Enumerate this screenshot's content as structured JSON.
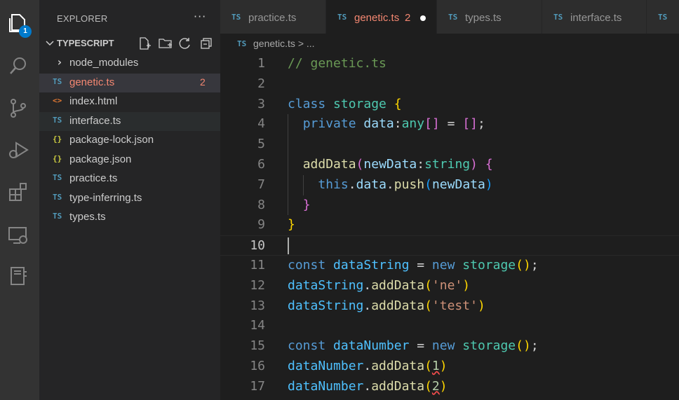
{
  "activity_bar": {
    "items": [
      {
        "name": "explorer-icon",
        "badge": "1"
      },
      {
        "name": "search-icon"
      },
      {
        "name": "source-control-icon"
      },
      {
        "name": "run-debug-icon"
      },
      {
        "name": "extensions-icon"
      },
      {
        "name": "remote-explorer-icon"
      },
      {
        "name": "notebook-icon"
      }
    ],
    "badge": "1"
  },
  "sidebar": {
    "title": "EXPLORER",
    "more": "···",
    "folder": "TYPESCRIPT",
    "items": [
      {
        "icon": "›",
        "name": "node_modules",
        "type": "folder"
      },
      {
        "icon": "TS",
        "name": "genetic.ts",
        "count": "2",
        "icon_color": "#519aba"
      },
      {
        "icon": "<>",
        "name": "index.html",
        "icon_color": "#e37933"
      },
      {
        "icon": "TS",
        "name": "interface.ts",
        "icon_color": "#519aba"
      },
      {
        "icon": "{}",
        "name": "package-lock.json",
        "icon_color": "#cbcb41"
      },
      {
        "icon": "{}",
        "name": "package.json",
        "icon_color": "#cbcb41"
      },
      {
        "icon": "TS",
        "name": "practice.ts",
        "icon_color": "#519aba"
      },
      {
        "icon": "TS",
        "name": "type-inferring.ts",
        "icon_color": "#519aba"
      },
      {
        "icon": "TS",
        "name": "types.ts",
        "icon_color": "#519aba"
      }
    ]
  },
  "tabs": [
    {
      "icon": "TS",
      "label": "practice.ts"
    },
    {
      "icon": "TS",
      "label": "genetic.ts",
      "count": "2",
      "active": true
    },
    {
      "icon": "TS",
      "label": "types.ts"
    },
    {
      "icon": "TS",
      "label": "interface.ts"
    },
    {
      "icon": "TS",
      "label": ""
    }
  ],
  "breadcrumb": {
    "icon": "TS",
    "text": "genetic.ts > ..."
  },
  "code": {
    "line_numbers": [
      "1",
      "2",
      "3",
      "4",
      "5",
      "6",
      "7",
      "8",
      "9",
      "10",
      "11",
      "12",
      "13",
      "14",
      "15",
      "16",
      "17"
    ],
    "current_line": "10"
  },
  "colors": {
    "accent": "#007acc",
    "error": "#f48771",
    "ts_icon": "#519aba"
  }
}
